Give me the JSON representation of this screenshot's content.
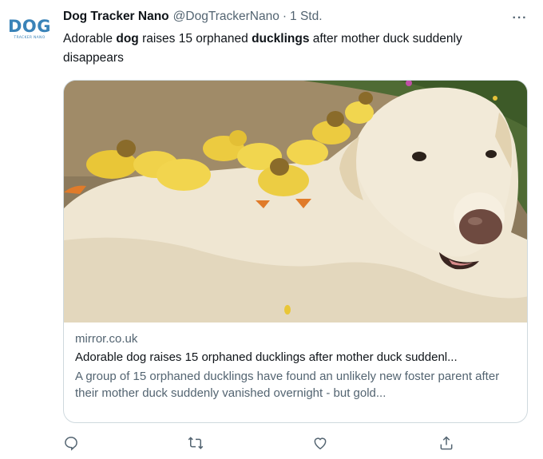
{
  "tweet": {
    "avatar_logo": "DOG",
    "avatar_logo_sub": "TRACKER NANO",
    "display_name": "Dog Tracker Nano",
    "handle": "@DogTrackerNano",
    "separator": "·",
    "time": "1 Std.",
    "more_label": "···",
    "text_parts": [
      "Adorable ",
      "dog",
      " raises 15 orphaned ",
      "ducklings",
      " after mother duck suddenly disappears"
    ]
  },
  "card": {
    "domain": "mirror.co.uk",
    "title": "Adorable dog raises 15 orphaned ducklings after mother duck suddenl...",
    "description": "A group of 15 orphaned ducklings have found an unlikely new foster parent after their mother duck suddenly vanished overnight - but gold..."
  },
  "actions": {
    "icons": [
      "reply-icon",
      "retweet-icon",
      "like-icon",
      "share-icon"
    ]
  },
  "colors": {
    "text": "#0f1419",
    "secondary": "#536471",
    "border": "#cfd9de",
    "logo": "#3a83b8"
  }
}
